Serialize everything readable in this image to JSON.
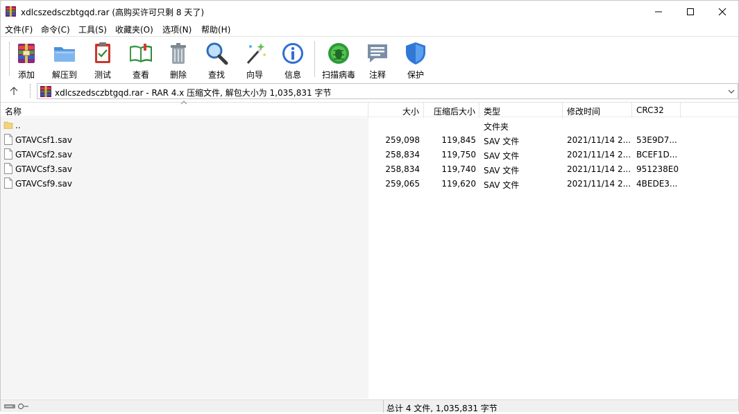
{
  "window": {
    "title": "xdlcszedsczbtgqd.rar (高购买许可只剩 8 天了)",
    "icon": "winrar-icon"
  },
  "menu": [
    {
      "label": "文件(F)"
    },
    {
      "label": "命令(C)"
    },
    {
      "label": "工具(S)"
    },
    {
      "label": "收藏夹(O)"
    },
    {
      "label": "选项(N)"
    },
    {
      "label": "帮助(H)"
    }
  ],
  "toolbar": {
    "buttons": [
      {
        "label": "添加",
        "icon": "add-archive-icon"
      },
      {
        "label": "解压到",
        "icon": "extract-folder-icon"
      },
      {
        "label": "测试",
        "icon": "test-clipboard-icon"
      },
      {
        "label": "查看",
        "icon": "view-book-icon"
      },
      {
        "label": "删除",
        "icon": "trash-icon"
      },
      {
        "label": "查找",
        "icon": "magnifier-icon"
      },
      {
        "label": "向导",
        "icon": "wizard-wand-icon"
      },
      {
        "label": "信息",
        "icon": "info-icon"
      },
      {
        "label": "扫描病毒",
        "icon": "virus-scan-icon"
      },
      {
        "label": "注释",
        "icon": "comment-icon"
      },
      {
        "label": "保护",
        "icon": "shield-icon"
      }
    ]
  },
  "address": {
    "text": "xdlcszedsczbtgqd.rar - RAR 4.x 压缩文件, 解包大小为 1,035,831 字节"
  },
  "columns": [
    {
      "key": "name",
      "label": "名称"
    },
    {
      "key": "size",
      "label": "大小"
    },
    {
      "key": "packed",
      "label": "压缩后大小"
    },
    {
      "key": "type",
      "label": "类型"
    },
    {
      "key": "modified",
      "label": "修改时间"
    },
    {
      "key": "crc",
      "label": "CRC32"
    }
  ],
  "rows": [
    {
      "name": "..",
      "size": "",
      "packed": "",
      "type": "文件夹",
      "modified": "",
      "crc": "",
      "kind": "folder"
    },
    {
      "name": "GTAVCsf1.sav",
      "size": "259,098",
      "packed": "119,845",
      "type": "SAV 文件",
      "modified": "2021/11/14 2...",
      "crc": "53E9D7...",
      "kind": "file"
    },
    {
      "name": "GTAVCsf2.sav",
      "size": "258,834",
      "packed": "119,750",
      "type": "SAV 文件",
      "modified": "2021/11/14 2...",
      "crc": "BCEF1D...",
      "kind": "file"
    },
    {
      "name": "GTAVCsf3.sav",
      "size": "258,834",
      "packed": "119,740",
      "type": "SAV 文件",
      "modified": "2021/11/14 2...",
      "crc": "951238E0",
      "kind": "file"
    },
    {
      "name": "GTAVCsf9.sav",
      "size": "259,065",
      "packed": "119,620",
      "type": "SAV 文件",
      "modified": "2021/11/14 2...",
      "crc": "4BEDE3...",
      "kind": "file"
    }
  ],
  "status": {
    "text": "总计 4 文件, 1,035,831 字节"
  },
  "colors": {
    "accent": "#1f6fd0",
    "folder": "#f5d27a"
  }
}
